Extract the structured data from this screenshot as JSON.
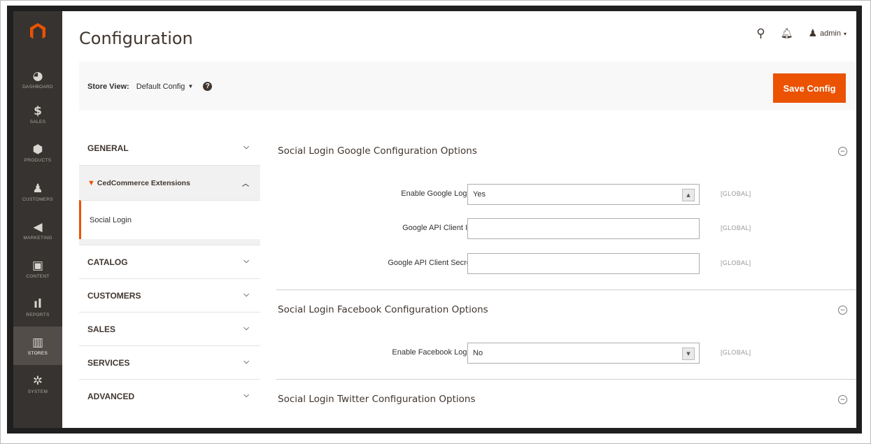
{
  "app": {
    "title": "Configuration",
    "header": {
      "user": "admin"
    }
  },
  "sidebar": {
    "items": [
      {
        "label": "DASHBOARD",
        "icon": "dashboard-icon",
        "glyph": "◕"
      },
      {
        "label": "SALES",
        "icon": "dollar-icon",
        "glyph": "$"
      },
      {
        "label": "PRODUCTS",
        "icon": "box-icon",
        "glyph": "⬢"
      },
      {
        "label": "CUSTOMERS",
        "icon": "person-icon",
        "glyph": "♟"
      },
      {
        "label": "MARKETING",
        "icon": "megaphone-icon",
        "glyph": "◀"
      },
      {
        "label": "CONTENT",
        "icon": "content-icon",
        "glyph": "▣"
      },
      {
        "label": "REPORTS",
        "icon": "bar-chart-icon",
        "glyph": "ıl"
      },
      {
        "label": "STORES",
        "icon": "store-icon",
        "glyph": "▥"
      },
      {
        "label": "SYSTEM",
        "icon": "gear-icon",
        "glyph": "✲"
      }
    ]
  },
  "actions": {
    "store_view_label": "Store View:",
    "store_view_value": "Default Config",
    "save_label": "Save Config"
  },
  "tabs": {
    "general": "GENERAL",
    "ced": "CedCommerce Extensions",
    "social_login": "Social Login",
    "catalog": "CATALOG",
    "customers": "CUSTOMERS",
    "sales": "SALES",
    "services": "SERVICES",
    "advanced": "ADVANCED"
  },
  "sections": {
    "google": {
      "title": "Social Login Google Configuration Options",
      "enable_label": "Enable Google Login",
      "enable_value": "Yes",
      "client_id_label": "Google API Client ID",
      "client_id_value": "",
      "client_secret_label": "Google API Client Secret",
      "client_secret_value": ""
    },
    "facebook": {
      "title": "Social Login Facebook Configuration Options",
      "enable_label": "Enable Facebook Login",
      "enable_value": "No"
    },
    "twitter": {
      "title": "Social Login Twitter Configuration Options"
    },
    "scope": "[GLOBAL]"
  },
  "colors": {
    "accent": "#eb5202",
    "sidebar": "#373330"
  }
}
